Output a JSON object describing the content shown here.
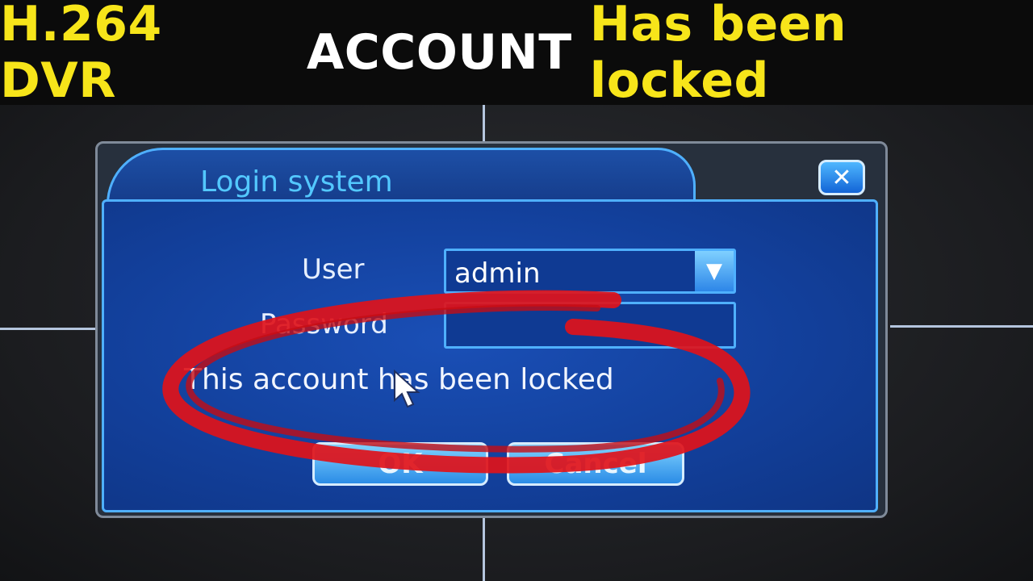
{
  "banner": {
    "part1": "H.264 DVR",
    "part2": "ACCOUNT",
    "part3": "Has been locked"
  },
  "dialog": {
    "title": "Login system",
    "close_glyph": "✕",
    "user_label": "User",
    "user_value": "admin",
    "password_label": "Password",
    "password_value": "",
    "message": "This account has been locked",
    "ok_label": "OK",
    "cancel_label": "Cancel"
  },
  "colors": {
    "banner_yellow": "#f7e51a",
    "dialog_blue": "#1a4fb6",
    "accent_cyan": "#4fb0ff",
    "annotation_red": "#e0121a"
  },
  "icons": {
    "close": "close-icon",
    "dropdown": "chevron-down-icon",
    "cursor": "mouse-pointer-icon"
  }
}
